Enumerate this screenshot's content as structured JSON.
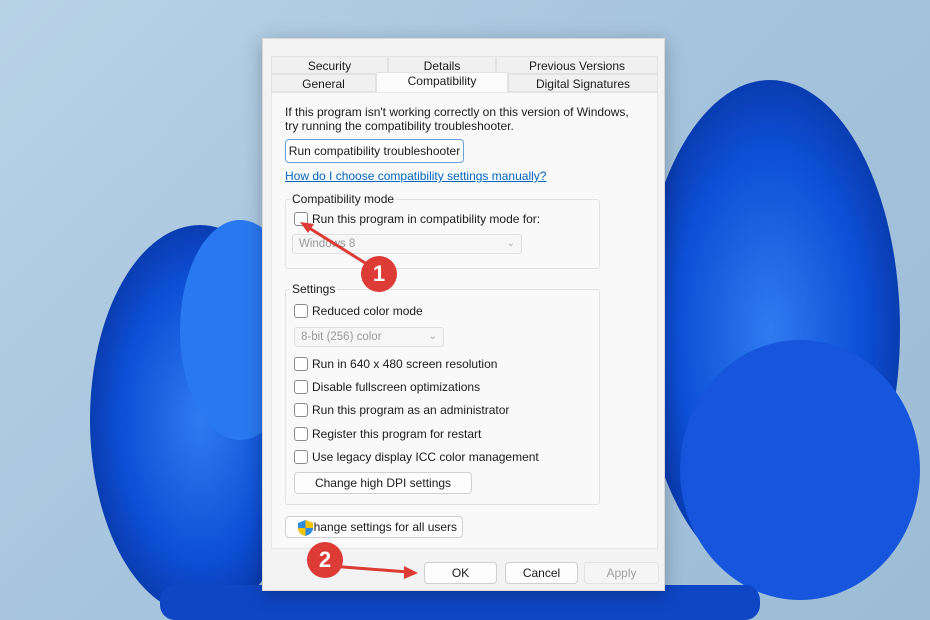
{
  "tabs": {
    "row1": [
      "Security",
      "Details",
      "Previous Versions"
    ],
    "row2": [
      "General",
      "Compatibility",
      "Digital Signatures"
    ],
    "active": "Compatibility"
  },
  "intro": "If this program isn't working correctly on this version of Windows, try running the compatibility troubleshooter.",
  "troubleshooter_button": "Run compatibility troubleshooter",
  "help_link": "How do I choose compatibility settings manually?",
  "compat_mode": {
    "title": "Compatibility mode",
    "checkbox": "Run this program in compatibility mode for:",
    "checked": false,
    "select_value": "Windows 8"
  },
  "settings": {
    "title": "Settings",
    "reduced_color": {
      "label": "Reduced color mode",
      "checked": false
    },
    "color_select": "8-bit (256) color",
    "options": [
      {
        "label": "Run in 640 x 480 screen resolution",
        "checked": false
      },
      {
        "label": "Disable fullscreen optimizations",
        "checked": false
      },
      {
        "label": "Run this program as an administrator",
        "checked": false
      },
      {
        "label": "Register this program for restart",
        "checked": false
      },
      {
        "label": "Use legacy display ICC color management",
        "checked": false
      }
    ],
    "dpi_button": "Change high DPI settings"
  },
  "all_users_button": "Change settings for all users",
  "footer": {
    "ok": "OK",
    "cancel": "Cancel",
    "apply": "Apply"
  },
  "annotations": [
    "1",
    "2"
  ],
  "colors": {
    "accent": "#0067c0",
    "annotation": "#dc3b36"
  }
}
